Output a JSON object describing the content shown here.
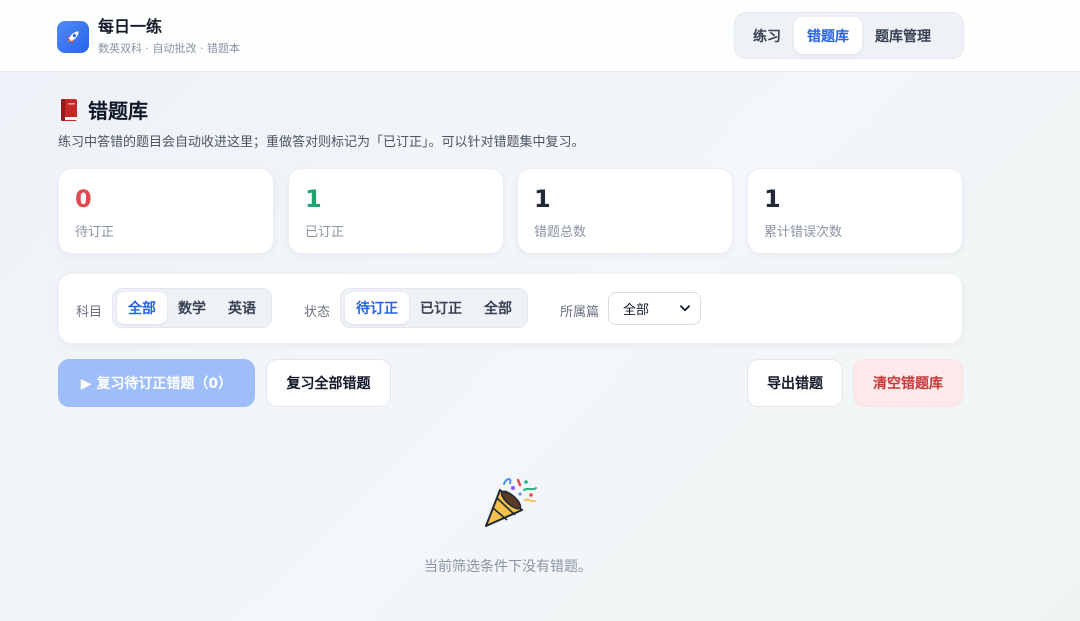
{
  "header": {
    "title": "每日一练",
    "subtitle": "数英双科 · 自动批改 · 错题本",
    "nav": [
      {
        "label": "练习",
        "active": false
      },
      {
        "label": "错题库",
        "active": true
      },
      {
        "label": "题库管理",
        "active": false
      }
    ]
  },
  "page": {
    "title": "错题库",
    "description": "练习中答错的题目会自动收进这里；重做答对则标记为「已订正」。可以针对错题集中复习。"
  },
  "stats": [
    {
      "value": "0",
      "label": "待订正",
      "color": "#e04a4f"
    },
    {
      "value": "1",
      "label": "已订正",
      "color": "#1ea672"
    },
    {
      "value": "1",
      "label": "错题总数",
      "color": "#1f2937"
    },
    {
      "value": "1",
      "label": "累计错误次数",
      "color": "#1f2937"
    }
  ],
  "filters": {
    "subject_label": "科目",
    "subject_options": [
      "全部",
      "数学",
      "英语"
    ],
    "subject_selected": "全部",
    "status_label": "状态",
    "status_options": [
      "待订正",
      "已订正",
      "全部"
    ],
    "status_selected": "待订正",
    "chapter_label": "所属篇",
    "chapter_value": "全部"
  },
  "actions": {
    "review_pending": "▶ 复习待订正错题（0）",
    "review_all": "复习全部错题",
    "export": "导出错题",
    "clear": "清空错题库"
  },
  "empty_state": {
    "icon": "party-popper-icon",
    "message": "当前筛选条件下没有错题。"
  },
  "colors": {
    "accent": "#2563eb",
    "danger": "#c7373a",
    "primary_disabled": "#9dbdfb"
  }
}
